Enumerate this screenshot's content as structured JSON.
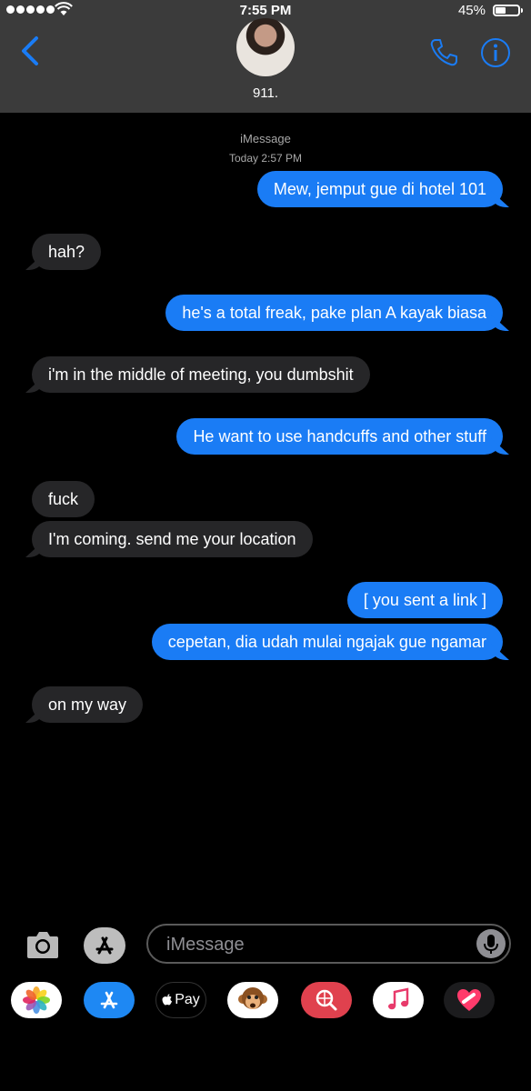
{
  "status_bar": {
    "time": "7:55 PM",
    "battery": "45%"
  },
  "contact": {
    "name": "911."
  },
  "thread": {
    "service": "iMessage",
    "timestamp": "Today 2:57 PM",
    "messages": [
      {
        "from": "me",
        "text": "Mew, jemput gue di hotel 101"
      },
      {
        "from": "them",
        "text": "hah?"
      },
      {
        "from": "me",
        "text": "he's a total freak, pake plan A kayak biasa"
      },
      {
        "from": "them",
        "text": "i'm in the middle of meeting, you dumbshit"
      },
      {
        "from": "me",
        "text": "He want to use handcuffs and other stuff"
      },
      {
        "from": "them",
        "text": "fuck"
      },
      {
        "from": "them",
        "text": "I'm coming. send me your location"
      },
      {
        "from": "me",
        "text": "[ you sent a link ]"
      },
      {
        "from": "me",
        "text": "cepetan, dia udah mulai ngajak gue ngamar"
      },
      {
        "from": "them",
        "text": "on my way"
      }
    ]
  },
  "compose": {
    "placeholder": "iMessage"
  },
  "app_drawer": {
    "apple_pay_label": "Pay",
    "apps": [
      "photos-icon",
      "app-store-icon",
      "apple-pay-icon",
      "animoji-icon",
      "search-web-icon",
      "music-icon",
      "digital-touch-icon"
    ]
  },
  "colors": {
    "accent": "#1a7cf5",
    "incoming_bubble": "#262628",
    "header_bg": "#3b3b3b"
  }
}
